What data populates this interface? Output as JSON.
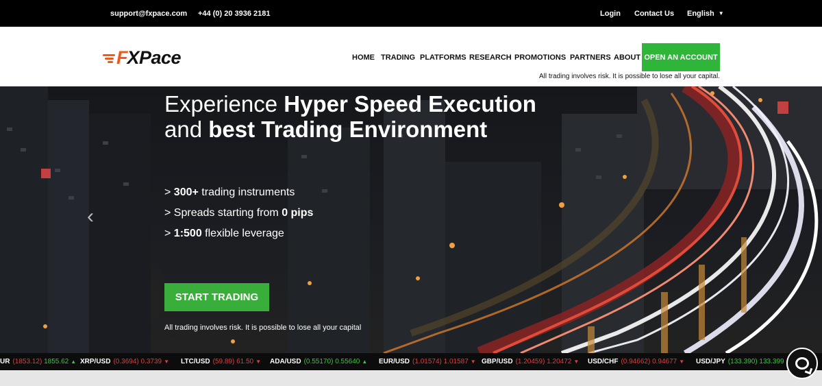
{
  "topbar": {
    "email": "support@fxpace.com",
    "phone": "+44 (0) 20 3936 2181",
    "login": "Login",
    "contact": "Contact Us",
    "language": "English"
  },
  "brand": {
    "logo_f": "F",
    "logo_rest": "XPace",
    "accent_color": "#ef5a1c"
  },
  "nav": {
    "items": [
      "HOME",
      "TRADING",
      "PLATFORMS",
      "RESEARCH",
      "PROMOTIONS",
      "PARTNERS",
      "ABOUT"
    ],
    "cta": "OPEN AN ACCOUNT",
    "cta_color": "#2fb539",
    "risk": "All trading involves risk. It is possible to lose all your capital."
  },
  "hero": {
    "headline_line1_normal": "Experience ",
    "headline_line1_bold": "Hyper Speed Execution",
    "headline_line2_normal": "and ",
    "headline_line2_bold": "best Trading Environment",
    "bullets": [
      {
        "prefix": "> ",
        "bold": "300+",
        "text": " trading instruments"
      },
      {
        "prefix": "> Spreads starting from ",
        "bold": "0 pips",
        "text": ""
      },
      {
        "prefix": "> ",
        "bold": "1:500",
        "text": " flexible leverage"
      }
    ],
    "start_button": "START TRADING",
    "risk": "All trading involves risk. It is possible to lose all your capital"
  },
  "ticker": [
    {
      "symbol": "UR",
      "bid": "1853.12",
      "ask": "1855.62",
      "bid_color": "red",
      "ask_color": "green",
      "dir": "up"
    },
    {
      "symbol": "XRP/USD",
      "bid": "0.3694",
      "ask": "0.3739",
      "bid_color": "red",
      "ask_color": "red",
      "dir": "down"
    },
    {
      "symbol": "LTC/USD",
      "bid": "59.89",
      "ask": "61.50",
      "bid_color": "red",
      "ask_color": "red",
      "dir": "down"
    },
    {
      "symbol": "ADA/USD",
      "bid": "0.55170",
      "ask": "0.55640",
      "bid_color": "green",
      "ask_color": "green",
      "dir": "up"
    },
    {
      "symbol": "EUR/USD",
      "bid": "1.01574",
      "ask": "1.01587",
      "bid_color": "red",
      "ask_color": "red",
      "dir": "down"
    },
    {
      "symbol": "GBP/USD",
      "bid": "1.20459",
      "ask": "1.20472",
      "bid_color": "red",
      "ask_color": "red",
      "dir": "down"
    },
    {
      "symbol": "USD/CHF",
      "bid": "0.94662",
      "ask": "0.94677",
      "bid_color": "red",
      "ask_color": "red",
      "dir": "down"
    },
    {
      "symbol": "USD/JPY",
      "bid": "133.390",
      "ask": "133.399",
      "bid_color": "green",
      "ask_color": "green",
      "dir": "up"
    }
  ],
  "icons": {
    "prev": "chevron-left-icon",
    "chat": "chat-icon",
    "lang_caret": "caret-down-icon"
  }
}
